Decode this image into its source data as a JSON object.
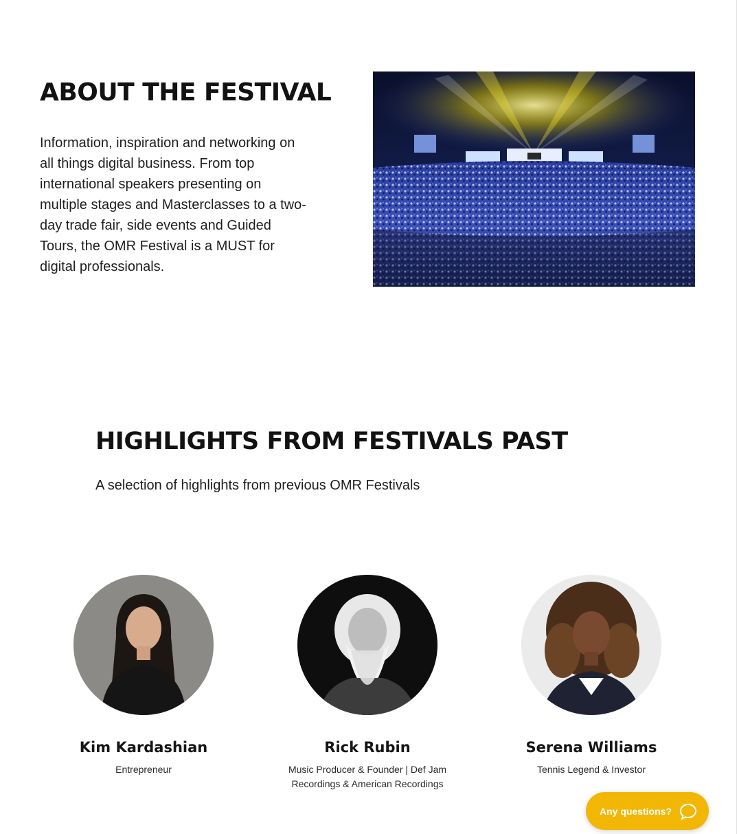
{
  "about": {
    "title": "ABOUT THE FESTIVAL",
    "text": "Information, inspiration and networking on all things digital business. From top international speakers presenting on multiple stages and Masterclasses to a two-day trade fair, side events and Guided Tours, the OMR Festival is a MUST for digital professionals.",
    "image_icon": "festival-crowd-photo"
  },
  "highlights": {
    "title": "HIGHLIGHTS FROM FESTIVALS PAST",
    "subtitle": "A selection of highlights from previous OMR Festivals",
    "speakers": [
      {
        "name": "Kim Kardashian",
        "role": "Entrepreneur"
      },
      {
        "name": "Rick Rubin",
        "role": "Music Producer & Founder | Def Jam Recordings & American Recordings"
      },
      {
        "name": "Serena Williams",
        "role": "Tennis Legend & Investor"
      }
    ]
  },
  "help_widget": {
    "label": "Any questions?",
    "icon": "chat-bubble-icon",
    "color": "#f2b705"
  }
}
